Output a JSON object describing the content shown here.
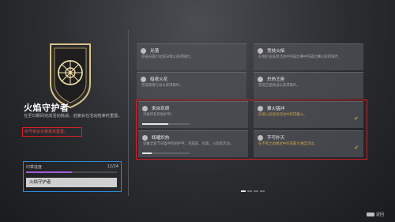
{
  "seal": {
    "title": "火焰守护者",
    "description": "在至日期间完成活动挑战，进度会在活动结束时重置。",
    "warning": "称号被会在赛季末重置。"
  },
  "progress": {
    "label": "印章进度",
    "count": "12/24",
    "value": 0.5,
    "button": "火焰守护者"
  },
  "triumphs": [
    {
      "name": "光落",
      "sub": "完成光操行动或日黎以获得银叶。",
      "done": false
    },
    {
      "name": "竞技火焰",
      "sub": "在熔炉竞技场活动中完成比赛中完成比赛以获得银叶。",
      "done": false
    },
    {
      "name": "暗夜火花",
      "sub": "完成暗夜行动以获得银叶。",
      "done": false
    },
    {
      "name": "炽热王座",
      "sub": "完成王座挑战以获得银叶。",
      "done": false
    },
    {
      "name": "来自灰烬",
      "sub": "升级所有的防护甲。",
      "done": false,
      "progress": 0.55
    },
    {
      "name": "翼火猛冲",
      "sub": "在熔火竞技场活动中获得翼火。",
      "done": true
    },
    {
      "name": "辉耀炽热",
      "sub": "穿戴全套节日盔甲的防护甲，完成前、风景、火焰等活动。",
      "done": false,
      "progress": 0.2
    },
    {
      "name": "不可扑灭",
      "sub": "在不死之焰模式中完成最大难度活动。",
      "done": true
    }
  ],
  "back_label": "返回",
  "colors": {
    "highlight_red": "#d81f26",
    "highlight_blue": "#2f8bd7",
    "progress_purple": "#a25fd8",
    "gold": "#c9a24b"
  }
}
